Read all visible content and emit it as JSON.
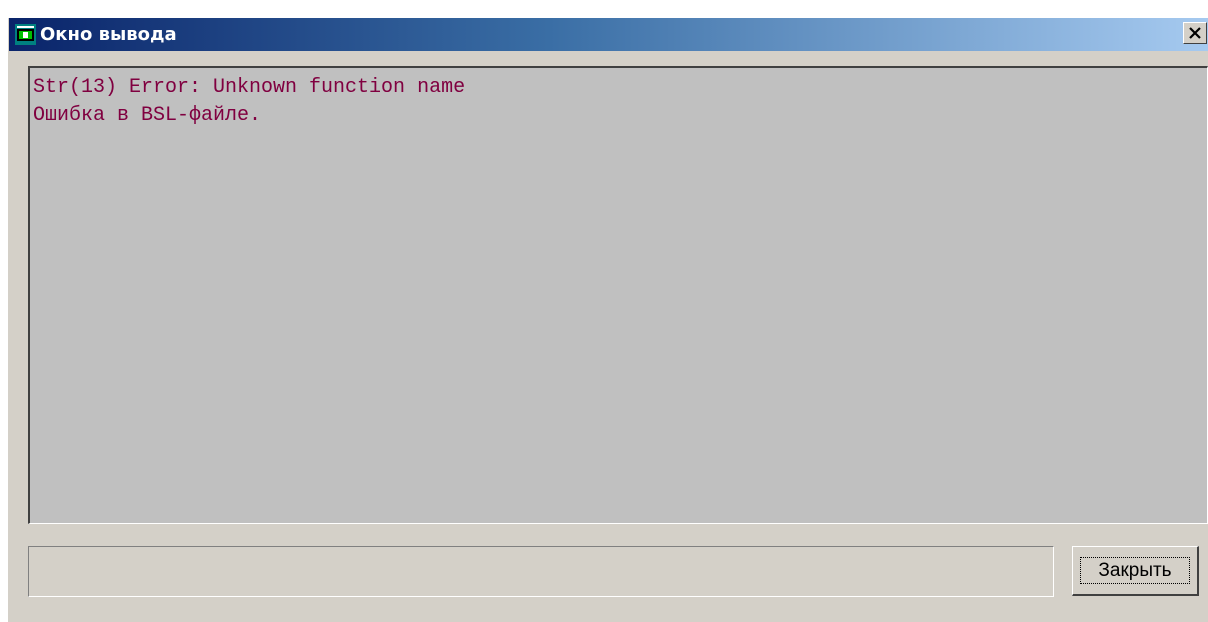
{
  "window": {
    "title": "Окно вывода",
    "icon": "output-window-icon",
    "close_icon": "close-icon"
  },
  "output": {
    "lines": [
      "Str(13) Error: Unknown function name",
      "Ошибка в BSL-файле."
    ],
    "text_color": "#800040",
    "background": "#c0c0c0"
  },
  "status": {
    "value": ""
  },
  "buttons": {
    "close_label": "Закрыть"
  }
}
